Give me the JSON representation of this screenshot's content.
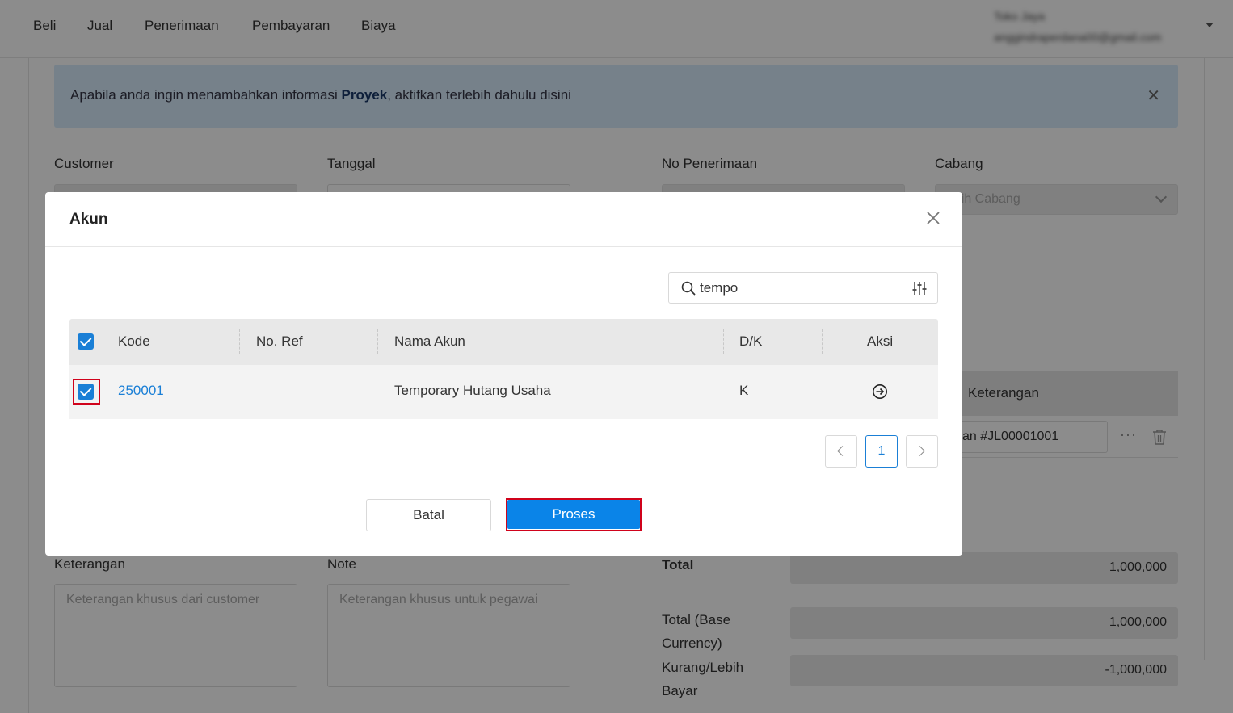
{
  "topnav": {
    "items": [
      "Beli",
      "Jual",
      "Penerimaan",
      "Pembayaran",
      "Biaya"
    ],
    "user_name": "Toko Jaya",
    "user_email": "anggindraperdana00@gmail.com"
  },
  "alert": {
    "text_before": "Apabila anda ingin menambahkan informasi ",
    "text_bold": "Proyek",
    "text_after": ", aktifkan terlebih dahulu disini"
  },
  "form": {
    "customer_label": "Customer",
    "tanggal_label": "Tanggal",
    "no_penerimaan_label": "No Penerimaan",
    "cabang_label": "Cabang",
    "cabang_placeholder": "Pilih Cabang",
    "keterangan_label": "Keterangan",
    "keterangan_placeholder": "Keterangan khusus dari customer",
    "note_label": "Note",
    "note_placeholder": "Keterangan khusus untuk pegawai"
  },
  "line_table": {
    "header_keterangan": "Keterangan",
    "row_keterangan_value": "an #JL00001001"
  },
  "summary": {
    "total_label": "Total",
    "total_value": "1,000,000",
    "total_base_label_1": "Total (Base",
    "total_base_label_2": "Currency)",
    "total_base_value": "1,000,000",
    "kurang_label_1": "Kurang/Lebih",
    "kurang_label_2": "Bayar",
    "kurang_value": "-1,000,000"
  },
  "modal": {
    "title": "Akun",
    "search_value": "tempo",
    "columns": {
      "kode": "Kode",
      "no_ref": "No. Ref",
      "nama_akun": "Nama Akun",
      "dk": "D/K",
      "aksi": "Aksi"
    },
    "rows": [
      {
        "kode": "250001",
        "no_ref": "",
        "nama_akun": "Temporary Hutang Usaha",
        "dk": "K",
        "checked": true
      }
    ],
    "pagination": {
      "current_page": "1"
    },
    "batal_label": "Batal",
    "proses_label": "Proses"
  },
  "colors": {
    "accent": "#1a7fd6",
    "primary_button": "#0a84e8",
    "highlight": "#d0021b"
  }
}
